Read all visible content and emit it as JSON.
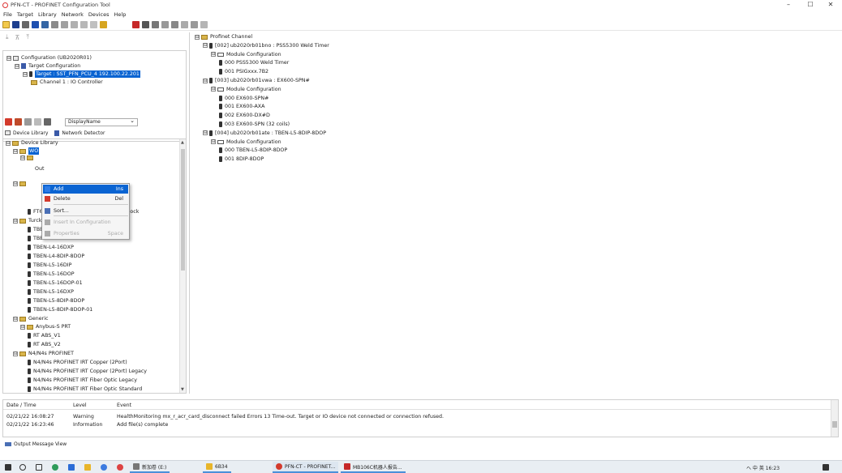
{
  "window": {
    "title": "PFN-CT - PROFINET Configuration Tool",
    "controls": [
      "–",
      "☐",
      "✕"
    ]
  },
  "menu": [
    "File",
    "Target",
    "Library",
    "Network",
    "Devices",
    "Help"
  ],
  "config_tree": [
    {
      "label": "Configuration (UB2020R01)",
      "level": 0,
      "exp": "⊟",
      "icon": "cfg"
    },
    {
      "label": "Target Configuration",
      "level": 1,
      "exp": "⊟",
      "icon": "tgt"
    },
    {
      "label": "Target : SST_PFN_PCU_4  192.100.22.201",
      "level": 2,
      "exp": "⊟",
      "icon": "dev",
      "selected": true
    },
    {
      "label": "Channel 1 : IO Controller",
      "level": 3,
      "exp": "",
      "icon": "fold"
    }
  ],
  "library_toolbar": {
    "dropdown_value": "DisplayName"
  },
  "library_tabs": [
    {
      "label": "Device Library"
    },
    {
      "label": "Network Detector"
    }
  ],
  "library_tree": [
    {
      "label": "Device Library",
      "level": 0,
      "exp": "⊟",
      "icon": "fold"
    },
    {
      "label": "WO",
      "level": 1,
      "exp": "⊟",
      "icon": "fold",
      "selected": true
    },
    {
      "label": "",
      "level": 2,
      "exp": "⊟",
      "icon": "fold"
    },
    {
      "label": "Out",
      "level": 4,
      "exp": "",
      "icon": "none"
    },
    {
      "label": "",
      "level": 1,
      "exp": "⊟",
      "icon": "fold"
    },
    {
      "label": "put NPN block",
      "level": 5,
      "exp": "",
      "icon": "none"
    },
    {
      "label": "put PNP block",
      "level": 5,
      "exp": "",
      "icon": "none"
    },
    {
      "label": "FT67 PROFINET IO Device universal block",
      "level": 3,
      "exp": "",
      "icon": "dev"
    },
    {
      "label": "Turck",
      "level": 1,
      "exp": "⊟",
      "icon": "fold"
    },
    {
      "label": "TBEN-L4-16DIP",
      "level": 3,
      "exp": "",
      "icon": "dev"
    },
    {
      "label": "TBEN-L4-16DOP",
      "level": 3,
      "exp": "",
      "icon": "dev"
    },
    {
      "label": "TBEN-L4-16DXP",
      "level": 3,
      "exp": "",
      "icon": "dev"
    },
    {
      "label": "TBEN-L4-8DIP-8DOP",
      "level": 3,
      "exp": "",
      "icon": "dev"
    },
    {
      "label": "TBEN-L5-16DIP",
      "level": 3,
      "exp": "",
      "icon": "dev"
    },
    {
      "label": "TBEN-L5-16DOP",
      "level": 3,
      "exp": "",
      "icon": "dev"
    },
    {
      "label": "TBEN-L5-16DOP-01",
      "level": 3,
      "exp": "",
      "icon": "dev"
    },
    {
      "label": "TBEN-L5-16DXP",
      "level": 3,
      "exp": "",
      "icon": "dev"
    },
    {
      "label": "TBEN-L5-8DIP-8DOP",
      "level": 3,
      "exp": "",
      "icon": "dev"
    },
    {
      "label": "TBEN-L5-8DIP-8DOP-01",
      "level": 3,
      "exp": "",
      "icon": "dev"
    },
    {
      "label": "Generic",
      "level": 1,
      "exp": "⊟",
      "icon": "fold"
    },
    {
      "label": "Anybus-S PRT",
      "level": 2,
      "exp": "⊟",
      "icon": "fold"
    },
    {
      "label": "RT ABS_V1",
      "level": 3,
      "exp": "",
      "icon": "dev"
    },
    {
      "label": "RT ABS_V2",
      "level": 3,
      "exp": "",
      "icon": "dev"
    },
    {
      "label": "N4/N4s PROFINET",
      "level": 1,
      "exp": "⊟",
      "icon": "fold"
    },
    {
      "label": "N4/N4s PROFINET IRT Copper (2Port)",
      "level": 3,
      "exp": "",
      "icon": "dev"
    },
    {
      "label": "N4/N4s PROFINET IRT Copper (2Port) Legacy",
      "level": 3,
      "exp": "",
      "icon": "dev"
    },
    {
      "label": "N4/N4s PROFINET IRT Fiber Optic Legacy",
      "level": 3,
      "exp": "",
      "icon": "dev"
    },
    {
      "label": "N4/N4s PROFINET IRT Fiber Optic Standard",
      "level": 3,
      "exp": "",
      "icon": "dev"
    }
  ],
  "context_menu": [
    {
      "label": "Add",
      "shortcut": "Ins",
      "state": "highlighted",
      "color": "#2c7be5"
    },
    {
      "label": "Delete",
      "shortcut": "Del",
      "state": "normal",
      "color": "#d33a2c"
    },
    {
      "label": "Sort...",
      "shortcut": "",
      "state": "normal",
      "color": "#4a6fb5"
    },
    {
      "label": "Insert In Configuration",
      "shortcut": "",
      "state": "disabled",
      "color": "#aaaaaa"
    },
    {
      "label": "Properties",
      "shortcut": "Space",
      "state": "disabled",
      "color": "#aaaaaa"
    }
  ],
  "channel_tree": [
    {
      "label": "Profinet Channel",
      "level": 0,
      "exp": "⊟",
      "icon": "fold"
    },
    {
      "label": "[002] ub2020rb01bno : PSS5300 Weld Timer",
      "level": 1,
      "exp": "⊟",
      "icon": "dev"
    },
    {
      "label": "Module Configuration",
      "level": 2,
      "exp": "⊟",
      "icon": "mod"
    },
    {
      "label": "000 PSS5300 Weld Timer",
      "level": 3,
      "exp": "",
      "icon": "dev"
    },
    {
      "label": "001 PSIGxxx.7B2",
      "level": 3,
      "exp": "",
      "icon": "dev"
    },
    {
      "label": "[003] ub2020rb01vwa : EX600-SPN#",
      "level": 1,
      "exp": "⊟",
      "icon": "dev"
    },
    {
      "label": "Module Configuration",
      "level": 2,
      "exp": "⊟",
      "icon": "mod"
    },
    {
      "label": "000 EX600-SPN#",
      "level": 3,
      "exp": "",
      "icon": "dev"
    },
    {
      "label": "001 EX600-AXA",
      "level": 3,
      "exp": "",
      "icon": "dev"
    },
    {
      "label": "002 EX600-DX#D",
      "level": 3,
      "exp": "",
      "icon": "dev"
    },
    {
      "label": "003 EX600-SPN (32 coils)",
      "level": 3,
      "exp": "",
      "icon": "dev"
    },
    {
      "label": "[004] ub2020rb01ate : TBEN-L5-8DIP-8DOP",
      "level": 1,
      "exp": "⊟",
      "icon": "dev"
    },
    {
      "label": "Module Configuration",
      "level": 2,
      "exp": "⊟",
      "icon": "mod"
    },
    {
      "label": "000 TBEN-L5-8DIP-8DOP",
      "level": 3,
      "exp": "",
      "icon": "dev"
    },
    {
      "label": "001 8DIP-8DOP",
      "level": 3,
      "exp": "",
      "icon": "dev"
    }
  ],
  "output": {
    "headers": {
      "date": "Date / Time",
      "level": "Level",
      "event": "Event"
    },
    "rows": [
      {
        "date": "02/21/22 16:08:27",
        "level": "Warning",
        "event": "HealthMonitoring mx_r_acr_card_disconnect failed Errors 13 Time-out. Target or IO device not connected or connection refused."
      },
      {
        "date": "02/21/22 16:23:46",
        "level": "Information",
        "event": "Add file(s) complete"
      }
    ]
  },
  "output_tab": "Output Message View",
  "taskbar": {
    "items": [
      "新加卷 (E:)",
      "6B34",
      "PFN-CT - PROFINET...",
      "MB106C机器人报告..."
    ],
    "tray": "ヘ 中 英 16:23"
  },
  "colors": {
    "accent": "#0a64d2",
    "folder": "#d9b54a",
    "warning_icon": "#d33a2c"
  }
}
